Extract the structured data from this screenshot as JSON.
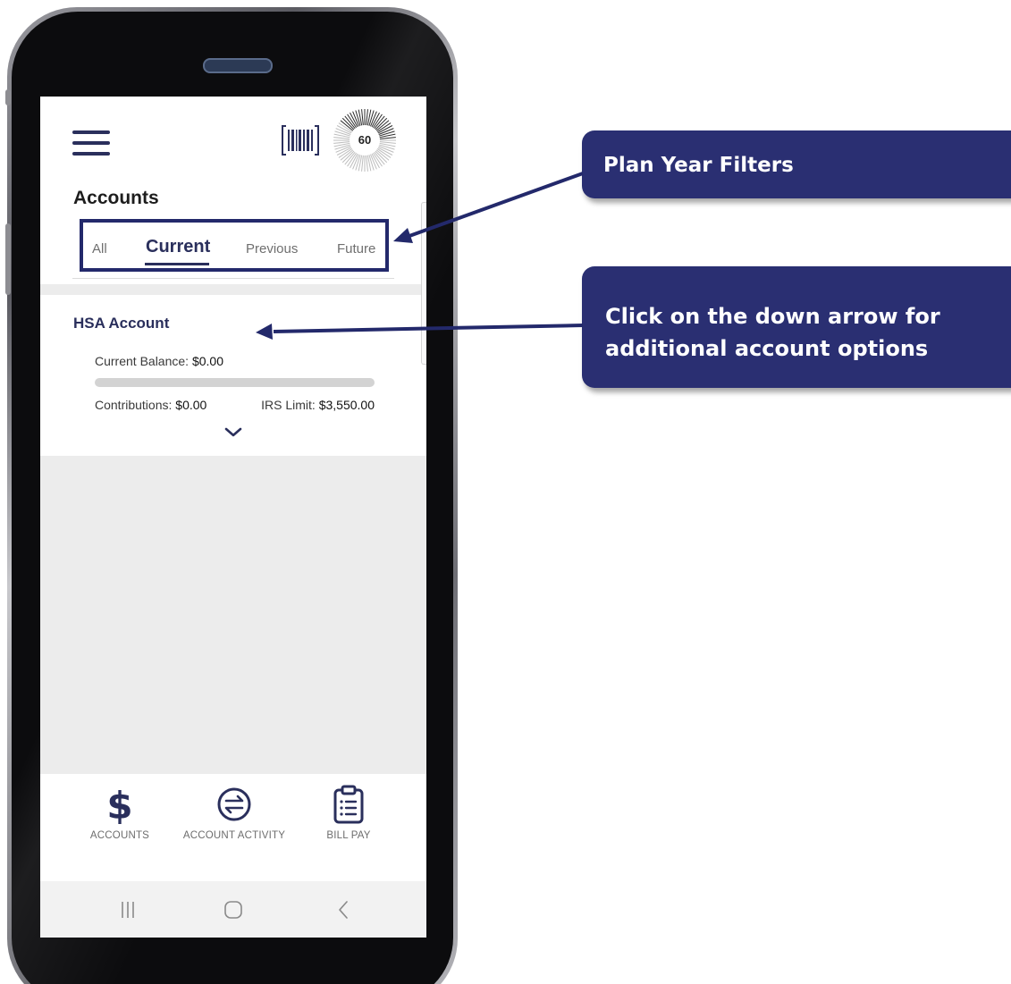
{
  "header": {
    "title": "Accounts",
    "score": "60",
    "menu_icon": "hamburger-menu-icon",
    "barcode_icon": "barcode-scan-icon"
  },
  "tabs": [
    {
      "label": "All",
      "active": false
    },
    {
      "label": "Current",
      "active": true
    },
    {
      "label": "Previous",
      "active": false
    },
    {
      "label": "Future",
      "active": false
    }
  ],
  "account": {
    "title": "HSA Account",
    "balance_label": "Current Balance:",
    "balance_value": "$0.00",
    "contributions_label": "Contributions:",
    "contributions_value": "$0.00",
    "irs_label": "IRS Limit:",
    "irs_value": "$3,550.00",
    "progress_fraction": 0,
    "expand_icon": "chevron-down-icon"
  },
  "bottom_nav": [
    {
      "label": "ACCOUNTS",
      "icon": "dollar-icon"
    },
    {
      "label": "ACCOUNT ACTIVITY",
      "icon": "exchange-arrows-icon"
    },
    {
      "label": "BILL PAY",
      "icon": "clipboard-list-icon"
    }
  ],
  "system_nav": {
    "recent_icon": "recent-apps-icon",
    "home_icon": "home-icon",
    "back_icon": "back-icon"
  },
  "callouts": {
    "plan_year": "Plan Year Filters",
    "down_arrow": "Click on the down arrow for additional account options"
  },
  "colors": {
    "brand_navy": "#2a2f5c",
    "callout_bg": "#2a2f72",
    "highlight_border": "#23296b"
  }
}
